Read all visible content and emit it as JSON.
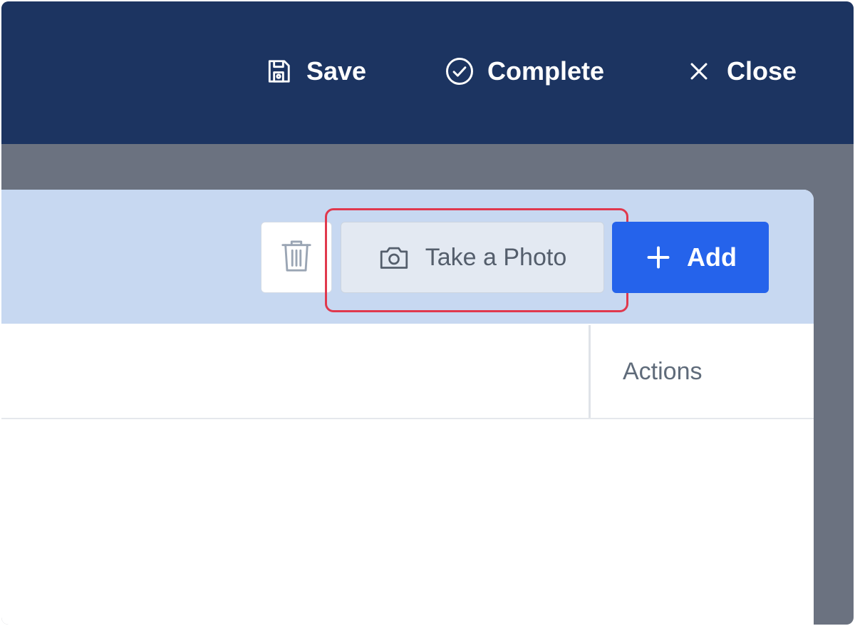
{
  "header": {
    "save_label": "Save",
    "complete_label": "Complete",
    "close_label": "Close",
    "icons": [
      "floppy-disk-icon",
      "check-circle-icon",
      "close-icon"
    ]
  },
  "toolbar": {
    "photo_label": "Take a Photo",
    "add_label": "Add",
    "icons": [
      "trash-icon",
      "camera-icon",
      "plus-icon"
    ]
  },
  "table": {
    "columns": [
      "",
      "Actions"
    ]
  },
  "colors": {
    "header_bg": "#1c3461",
    "page_bg": "#6b7280",
    "toolbar_bg": "#c7d8f1",
    "add_button": "#2563eb",
    "highlight": "#e0384d"
  }
}
